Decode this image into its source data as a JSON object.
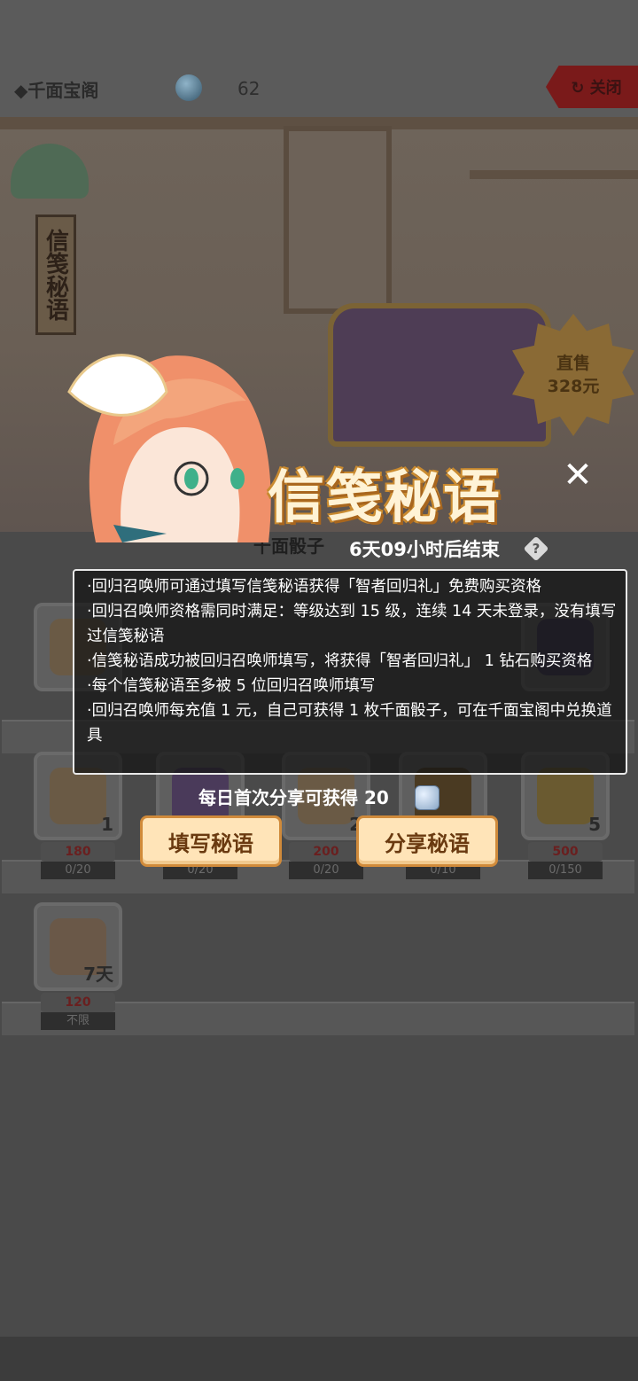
{
  "header": {
    "shop_title": "◆千面宝阁",
    "gem_count": "62",
    "close_label": "↻ 关闭"
  },
  "banner": {
    "scroll_text": "信笺秘语",
    "badge_line1": "直售",
    "badge_line2": "328元"
  },
  "shop": {
    "dice_label": "千面骰子",
    "items": [
      {
        "qty": "1",
        "price": "180",
        "stock": "0/20"
      },
      {
        "qty": "",
        "price": "",
        "stock": "0/20"
      },
      {
        "qty": "2",
        "price": "200",
        "stock": "0/20"
      },
      {
        "qty": "",
        "price": "",
        "stock": "0/10"
      },
      {
        "qty": "5",
        "price": "500",
        "stock": "0/150"
      },
      {
        "qty": "7天",
        "price": "120",
        "stock": "不限"
      }
    ]
  },
  "popup": {
    "title": "信笺秘语",
    "close_symbol": "✕",
    "timer": "6天09小时后结束",
    "help_symbol": "?",
    "rules": [
      "·回归召唤师可通过填写信笺秘语获得「智者回归礼」免费购买资格",
      "·回归召唤师资格需同时满足：等级达到 15 级，连续 14 天未登录，没有填写过信笺秘语",
      "·信笺秘语成功被回归召唤师填写，将获得「智者回归礼」 1 钻石购买资格",
      "·每个信笺秘语至多被 5 位回归召唤师填写",
      "·回归召唤师每充值 1 元，自己可获得 1 枚千面骰子，可在千面宝阁中兑换道具"
    ],
    "share_tip": "每日首次分享可获得 20",
    "fill_button": "填写秘语",
    "share_button": "分享秘语"
  },
  "colors": {
    "button_fill": "#ffe4b8",
    "button_border": "#d08a3a",
    "title_text": "#fff3d6"
  }
}
